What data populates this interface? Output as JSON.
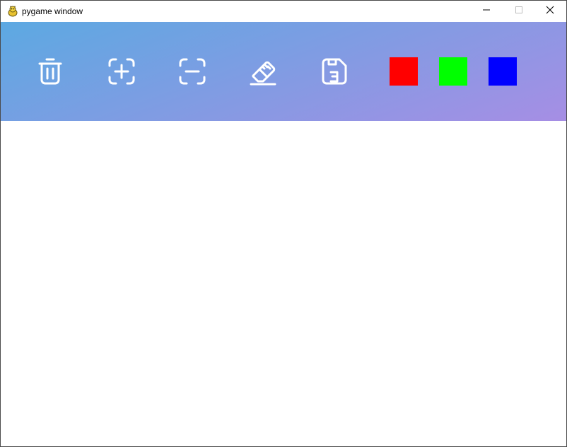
{
  "window": {
    "title": "pygame window",
    "app_icon": "pygame-snake-icon",
    "controls": {
      "minimize_icon": "minimize-icon",
      "maximize_icon": "maximize-icon",
      "close_icon": "close-icon"
    }
  },
  "toolbar": {
    "gradient": [
      "#5ca9e2",
      "#a68ee4"
    ],
    "tools": [
      {
        "name": "clear",
        "icon": "trash-icon"
      },
      {
        "name": "zoom-in",
        "icon": "scan-plus-icon"
      },
      {
        "name": "zoom-out",
        "icon": "scan-minus-icon"
      },
      {
        "name": "eraser",
        "icon": "eraser-icon"
      },
      {
        "name": "save",
        "icon": "save-icon"
      }
    ],
    "colors": [
      {
        "name": "red",
        "hex": "#ff0000"
      },
      {
        "name": "green",
        "hex": "#00ff00"
      },
      {
        "name": "blue",
        "hex": "#0000ff"
      }
    ]
  },
  "canvas": {
    "background": "#ffffff"
  }
}
